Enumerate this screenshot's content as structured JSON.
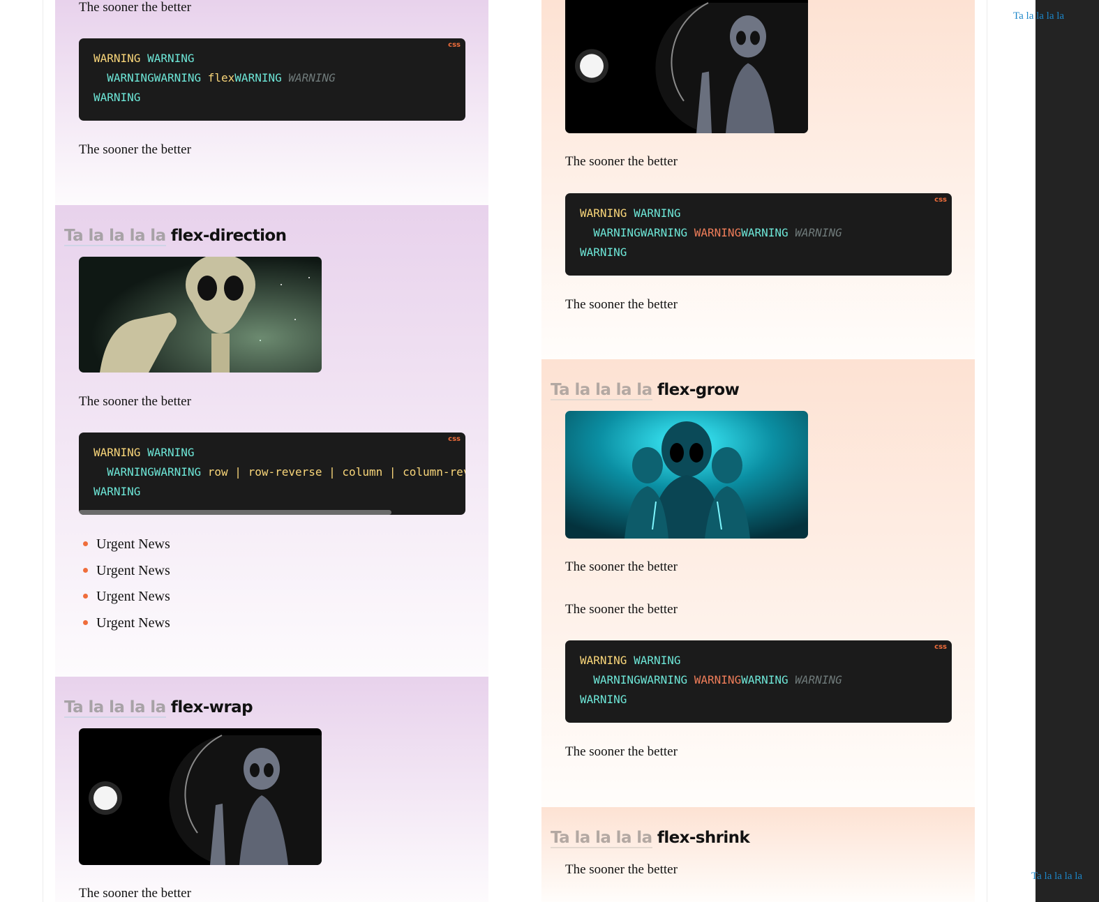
{
  "sidebar_links": {
    "top": "Ta la la la la",
    "bottom": "Ta la la la la"
  },
  "common": {
    "paragraph": "The sooner the better",
    "heading_prefix": "Ta la la la la",
    "code_lang": "css",
    "warning": "WARNING",
    "warning_pair": "WARNINGWARNING"
  },
  "left_column": {
    "card1": {
      "paragraph_top": "The sooner the better",
      "code_value": "flex",
      "paragraph_bottom": "The sooner the better"
    },
    "card2": {
      "heading": "flex-direction",
      "image_icon": "alien-pointing-image",
      "paragraph": "The sooner the better",
      "code_value": "row | row-reverse | column | column-reverse",
      "bullets": [
        "Urgent News",
        "Urgent News",
        "Urgent News",
        "Urgent News"
      ]
    },
    "card3": {
      "heading": "flex-wrap",
      "image_icon": "alien-waving-image",
      "paragraph": "The sooner the better"
    }
  },
  "right_column": {
    "card1": {
      "image_icon": "alien-waving-image",
      "paragraph_top": "The sooner the better",
      "paragraph_bottom": "The sooner the better"
    },
    "card2": {
      "heading": "flex-grow",
      "image_icon": "cyan-aliens-image",
      "paragraph1": "The sooner the better",
      "paragraph2": "The sooner the better",
      "paragraph3": "The sooner the better"
    },
    "card3": {
      "heading": "flex-shrink",
      "paragraph": "The sooner the better"
    }
  },
  "colors": {
    "purple_card": "#e8d2ec",
    "peach_card": "#fde2d3",
    "code_bg": "#1b1b1b",
    "keyword": "#f9d67a",
    "token": "#6ee7d8",
    "accent": "#ef6d3b",
    "link": "#1d86c8"
  }
}
